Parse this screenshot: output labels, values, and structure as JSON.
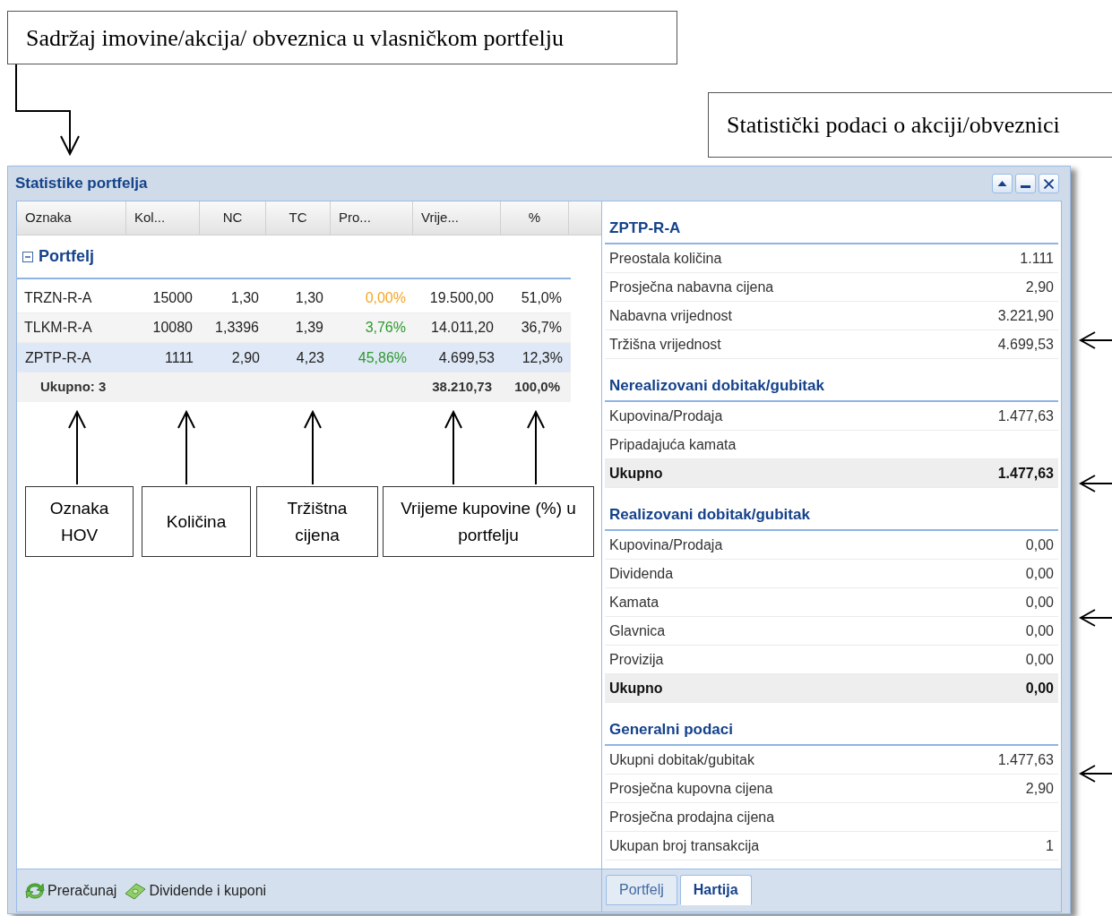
{
  "callouts_top": [
    "Sadržaj imovine/akcija/ obveznica u vlasničkom portfelju",
    "Statistički podaci o akciji/obveznici"
  ],
  "window": {
    "title": "Statistike portfelja"
  },
  "table": {
    "columns": [
      "Oznaka",
      "Kol...",
      "NC",
      "TC",
      "Pro...",
      "Vrije...",
      "%"
    ],
    "group": {
      "label": "Portfelj",
      "expanded": true
    },
    "rows": [
      {
        "cells": [
          "TRZN-R-A",
          "15000",
          "1,30",
          "1,30",
          "0,00%",
          "19.500,00",
          "51,0%"
        ],
        "kind": "flat",
        "selected": false
      },
      {
        "cells": [
          "TLKM-R-A",
          "10080",
          "1,3396",
          "1,39",
          "3,76%",
          "14.011,20",
          "36,7%"
        ],
        "kind": "up",
        "selected": false
      },
      {
        "cells": [
          "ZPTP-R-A",
          "1111",
          "2,90",
          "4,23",
          "45,86%",
          "4.699,53",
          "12,3%"
        ],
        "kind": "up",
        "selected": true
      }
    ],
    "total": {
      "label": "Ukupno: 3",
      "value": "38.210,73",
      "percent": "100,0%"
    }
  },
  "toolbar": [
    "Preračunaj",
    "Dividende i kuponi"
  ],
  "callouts_bottom": [
    "Oznaka HOV",
    "Količina",
    "Tržištna cijena",
    "Vrijeme kupovine (%) u portfelju"
  ],
  "details": [
    {
      "title": "ZPTP-R-A",
      "rows": [
        {
          "label": "Preostala količina",
          "value": "1.111",
          "kind": "normal"
        },
        {
          "label": "Prosječna nabavna cijena",
          "value": "2,90",
          "kind": "normal"
        },
        {
          "label": "Nabavna vrijednost",
          "value": "3.221,90",
          "kind": "normal"
        },
        {
          "label": "Tržišna vrijednost",
          "value": "4.699,53",
          "kind": "normal"
        }
      ]
    },
    {
      "title": "Nerealizovani dobitak/gubitak",
      "rows": [
        {
          "label": "Kupovina/Prodaja",
          "value": "1.477,63",
          "kind": "normal"
        },
        {
          "label": "Pripadajuća kamata",
          "kind": "normal"
        },
        {
          "label": "Ukupno",
          "value": "1.477,63",
          "kind": "total"
        }
      ]
    },
    {
      "title": "Realizovani dobitak/gubitak",
      "rows": [
        {
          "label": "Kupovina/Prodaja",
          "value": "0,00",
          "kind": "normal"
        },
        {
          "label": "Dividenda",
          "value": "0,00",
          "kind": "normal"
        },
        {
          "label": "Kamata",
          "value": "0,00",
          "kind": "normal"
        },
        {
          "label": "Glavnica",
          "value": "0,00",
          "kind": "normal"
        },
        {
          "label": "Provizija",
          "value": "0,00",
          "kind": "normal"
        },
        {
          "label": "Ukupno",
          "value": "0,00",
          "kind": "total"
        }
      ]
    },
    {
      "title": "Generalni podaci",
      "rows": [
        {
          "label": "Ukupni dobitak/gubitak",
          "value": "1.477,63",
          "kind": "normal"
        },
        {
          "label": "Prosječna kupovna cijena",
          "value": "2,90",
          "kind": "normal"
        },
        {
          "label": "Prosječna prodajna cijena",
          "kind": "normal"
        },
        {
          "label": "Ukupan broj transakcija",
          "value": "1",
          "kind": "normal"
        }
      ]
    }
  ],
  "tabs": [
    {
      "label": "Portfelj",
      "selected": false
    },
    {
      "label": "Hartija",
      "selected": true
    }
  ]
}
